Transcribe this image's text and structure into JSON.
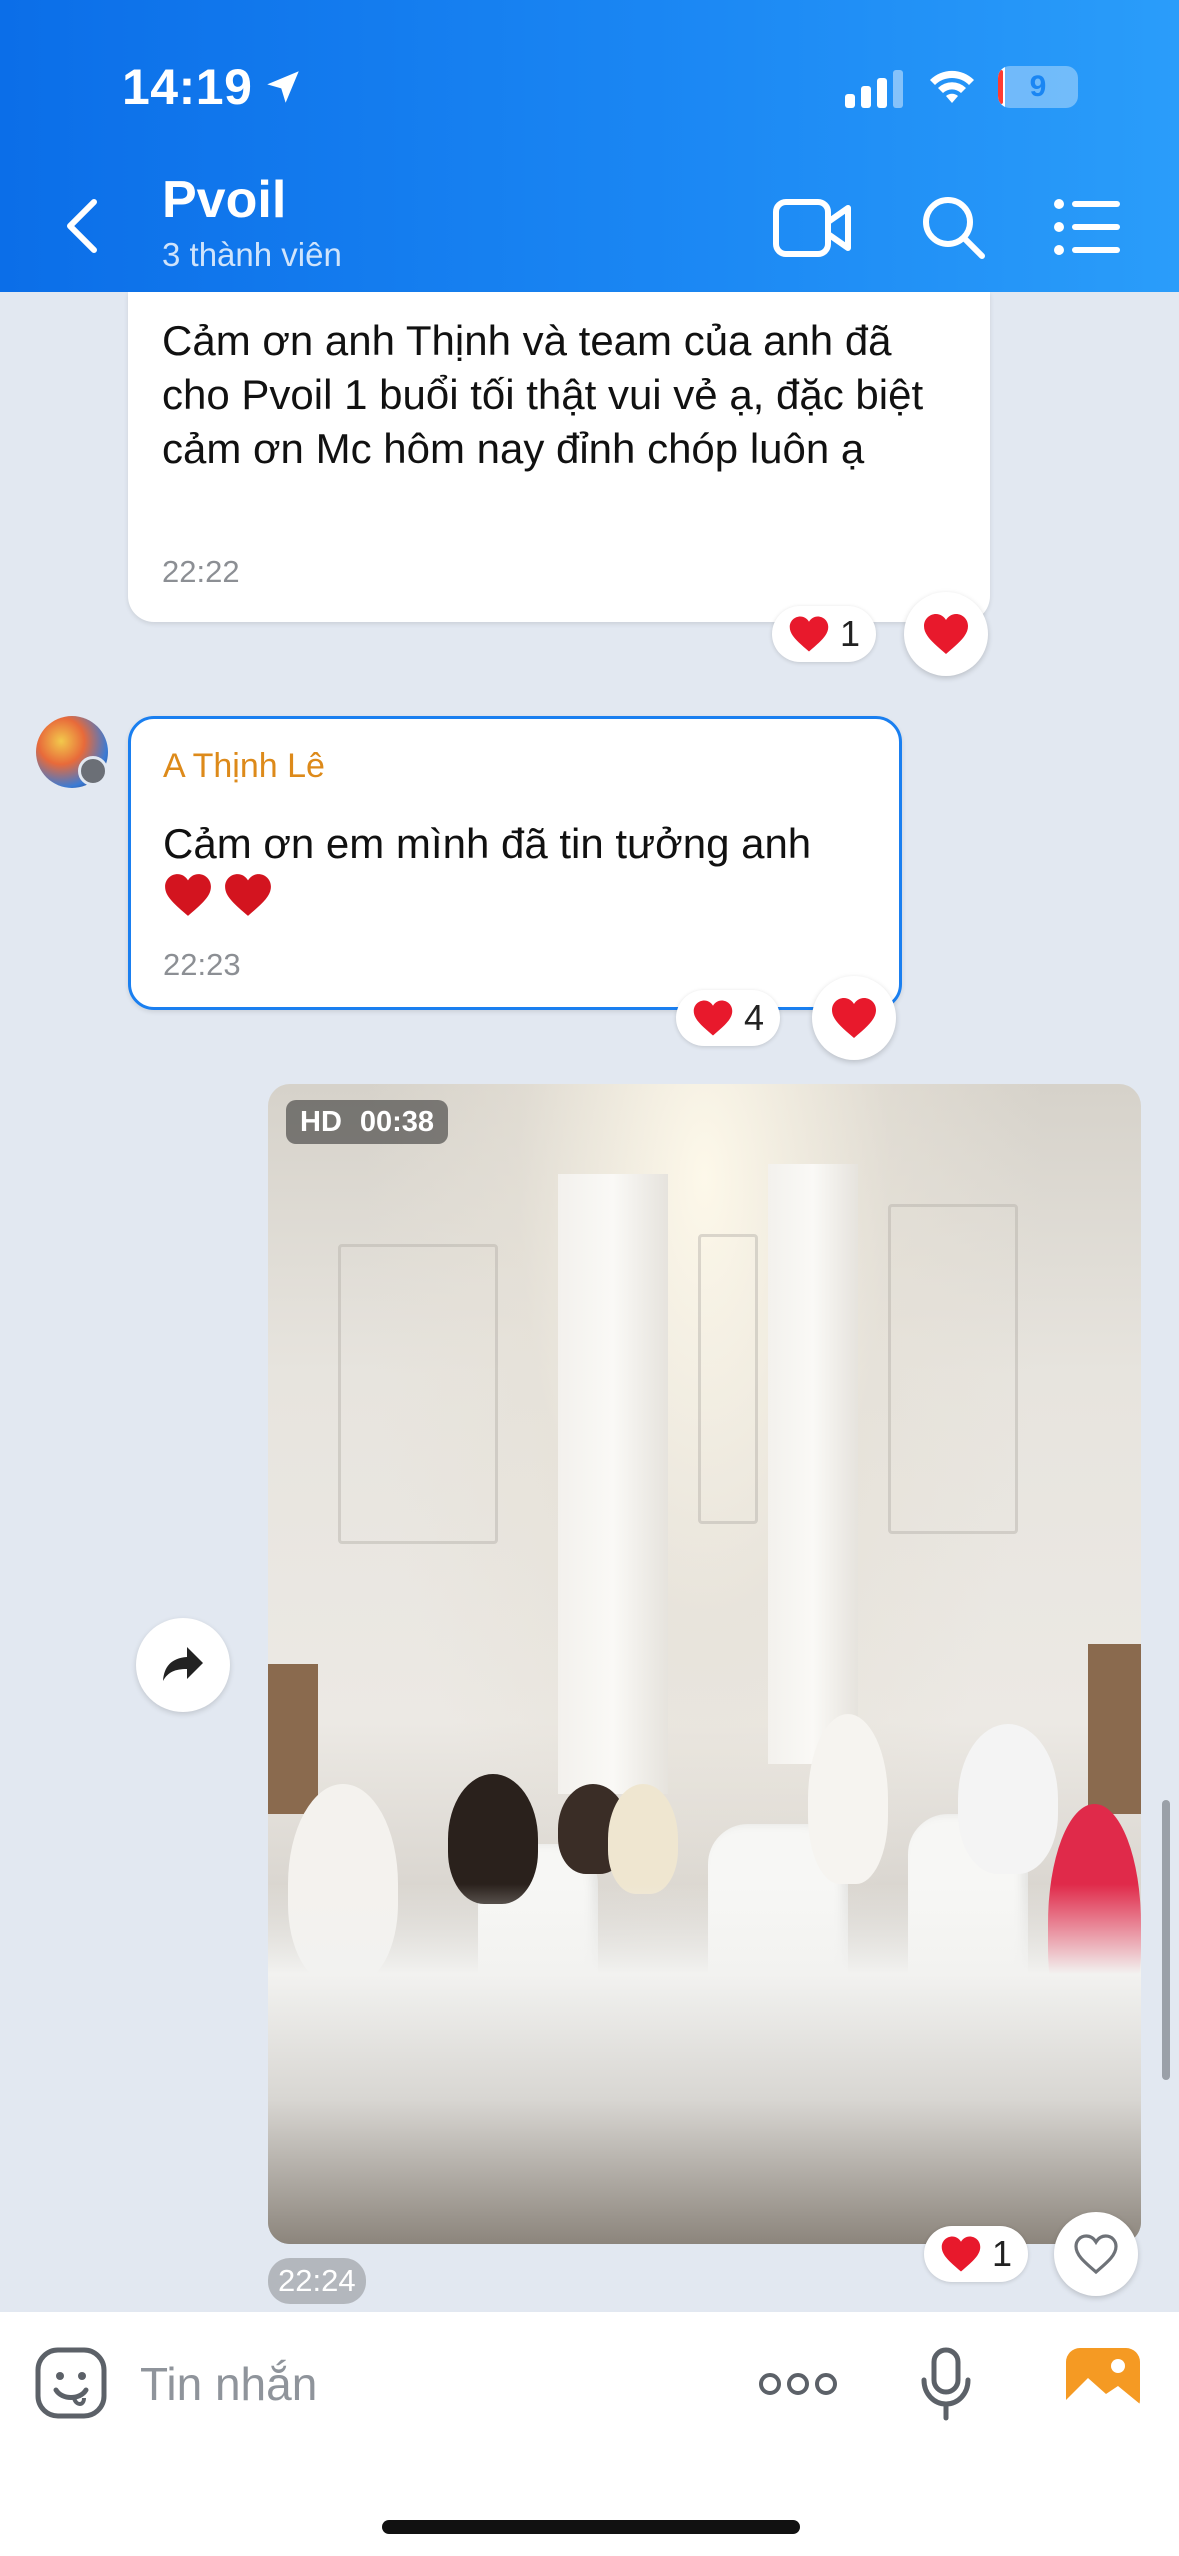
{
  "status_bar": {
    "time": "14:19",
    "battery_label": "9",
    "battery_level": 0.09
  },
  "header": {
    "title": "Pvoil",
    "subtitle": "3 thành viên"
  },
  "messages": [
    {
      "text": "Cảm ơn anh Thịnh và team của anh đã cho Pvoil 1 buổi tối thật vui vẻ ạ, đặc biệt cảm ơn Mc hôm nay đỉnh chóp luôn ạ",
      "time": "22:22",
      "reaction_count": "1"
    },
    {
      "sender": "A Thịnh Lê",
      "text": "Cảm ơn em mình đã tin tưởng anh",
      "time": "22:23",
      "reaction_count": "4"
    },
    {
      "type": "video",
      "quality": "HD",
      "duration": "00:38",
      "time": "22:24",
      "reaction_count": "1"
    }
  ],
  "input": {
    "placeholder": "Tin nhắn"
  },
  "colors": {
    "header_start": "#0b6ee8",
    "header_end": "#2a9dfa",
    "chat_background": "#e2e8f1",
    "sender_name": "#dd8a1a",
    "highlight_border": "#1a7ff0",
    "heart": "#e8192c"
  },
  "icons": {
    "status": [
      "location-arrow-icon",
      "signal-icon",
      "wifi-icon",
      "battery-icon"
    ],
    "header": [
      "back-icon",
      "video-call-icon",
      "search-icon",
      "menu-list-icon"
    ],
    "input": [
      "sticker-icon",
      "more-icon",
      "mic-icon",
      "photo-icon"
    ],
    "chat": [
      "heart-icon",
      "share-icon",
      "heart-outline-icon"
    ]
  }
}
